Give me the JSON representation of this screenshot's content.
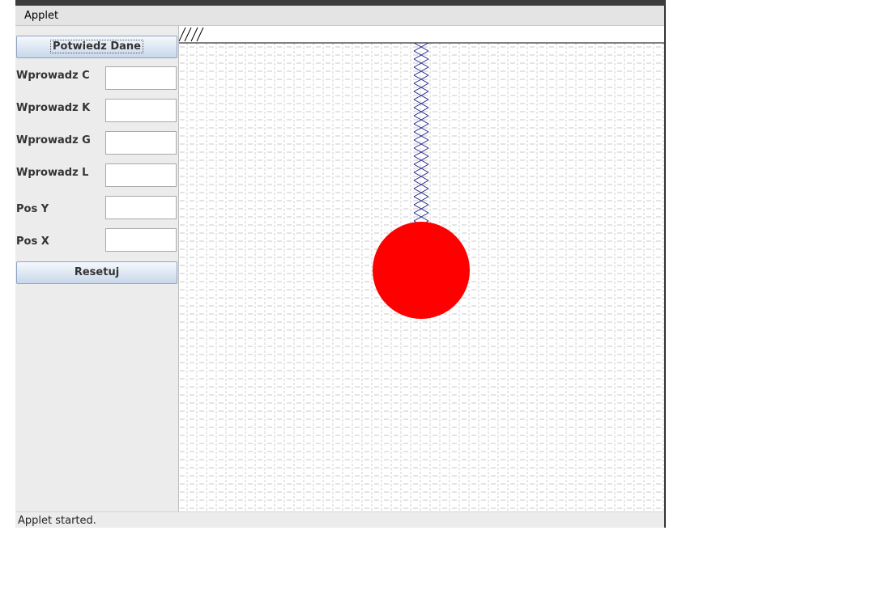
{
  "window": {
    "menu_label": "Applet"
  },
  "controls": {
    "confirm_button": "Potwiedz Dane",
    "reset_button": "Resetuj",
    "fields": [
      {
        "label": "Wprowadz C",
        "value": ""
      },
      {
        "label": "Wprowadz K",
        "value": ""
      },
      {
        "label": "Wprowadz G",
        "value": ""
      },
      {
        "label": "Wprowadz L",
        "value": ""
      },
      {
        "label": "Pos Y",
        "value": ""
      },
      {
        "label": "Pos X",
        "value": ""
      }
    ]
  },
  "status": {
    "text": "Applet started."
  },
  "colors": {
    "ball": "#ff0000",
    "spring": "#1a1a8a",
    "grid": "#c8c8c8",
    "ceiling": "#000000"
  },
  "icons": [
    "hatch-ceiling-icon",
    "spring-icon",
    "ball-icon"
  ]
}
